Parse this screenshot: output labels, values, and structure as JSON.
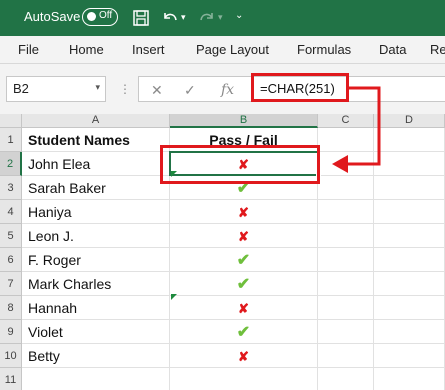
{
  "titlebar": {
    "autosave_label": "AutoSave",
    "toggle_text": "Off",
    "save_icon": "save-icon",
    "undo_icon": "undo-icon",
    "redo_icon": "redo-icon",
    "customize_icon": "chevron-down-icon"
  },
  "ribbon": {
    "tabs": [
      "File",
      "Home",
      "Insert",
      "Page Layout",
      "Formulas",
      "Data",
      "Re"
    ]
  },
  "formula_bar": {
    "name_box": "B2",
    "fx": "fx",
    "formula": "=CHAR(251)"
  },
  "sheet": {
    "columns": [
      "A",
      "B",
      "C",
      "D"
    ],
    "rows": [
      "1",
      "2",
      "3",
      "4",
      "5",
      "6",
      "7",
      "8",
      "9",
      "10",
      "11"
    ],
    "header": {
      "names": "Student Names",
      "status": "Pass / Fail"
    },
    "students": [
      {
        "name": "John Elea",
        "result": "✘"
      },
      {
        "name": "Sarah Baker",
        "result": "✔"
      },
      {
        "name": "Haniya",
        "result": "✘"
      },
      {
        "name": "Leon J.",
        "result": "✘"
      },
      {
        "name": "F. Roger",
        "result": "✔"
      },
      {
        "name": "Mark Charles",
        "result": "✔"
      },
      {
        "name": "Hannah",
        "result": "✘"
      },
      {
        "name": "Violet",
        "result": "✔"
      },
      {
        "name": "Betty",
        "result": "✘"
      }
    ],
    "selected_cell": "B2"
  },
  "colors": {
    "excel_green": "#217346",
    "annotation_red": "#e0191d",
    "check_green": "#6fbf3c"
  }
}
